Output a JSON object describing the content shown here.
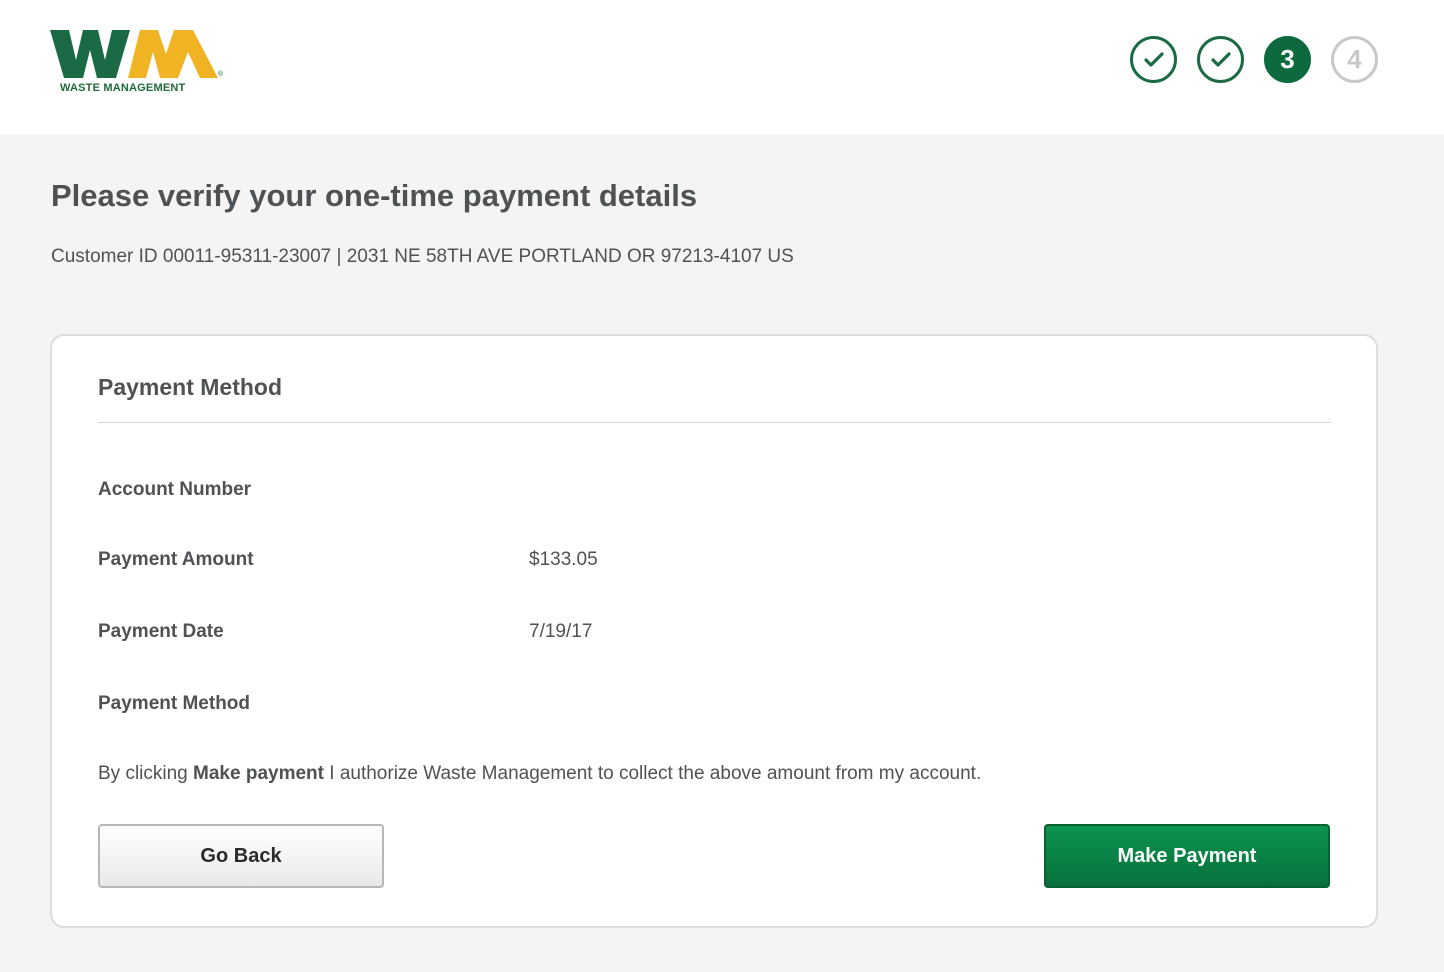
{
  "header": {
    "logo_text": "WASTE MANAGEMENT",
    "steps": [
      {
        "label": "",
        "state": "done",
        "icon": "check-icon"
      },
      {
        "label": "",
        "state": "done",
        "icon": "check-icon"
      },
      {
        "label": "3",
        "state": "current"
      },
      {
        "label": "4",
        "state": "todo"
      }
    ]
  },
  "page": {
    "title": "Please verify your one-time payment details",
    "customer_info": "Customer ID 00011-95311-23007 | 2031 NE 58TH AVE PORTLAND OR 97213-4107 US"
  },
  "card": {
    "title": "Payment Method",
    "rows": [
      {
        "label": "Account Number",
        "value": ""
      },
      {
        "label": "Payment Amount",
        "value": "$133.05"
      },
      {
        "label": "Payment Date",
        "value": "7/19/17"
      },
      {
        "label": "Payment Method",
        "value": ""
      }
    ],
    "auth_prefix": "By clicking ",
    "auth_bold": "Make payment",
    "auth_suffix": " I authorize Waste Management to collect the above amount from my account.",
    "back_label": "Go Back",
    "pay_label": "Make Payment"
  },
  "colors": {
    "brand_green": "#1a6b45",
    "brand_yellow": "#f0b323",
    "pay_button": "#07803f"
  }
}
